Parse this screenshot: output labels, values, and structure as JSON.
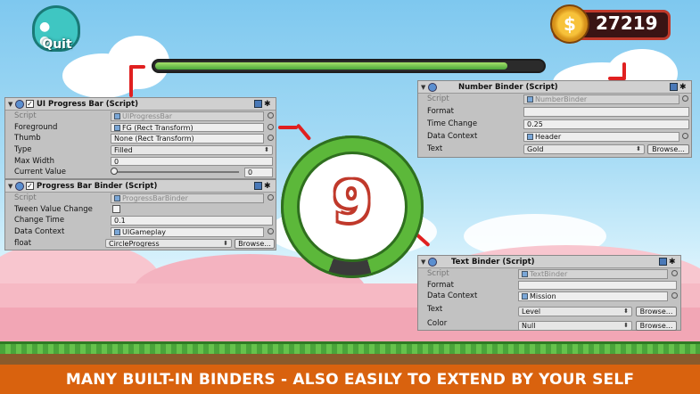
{
  "hud": {
    "quit_label": "Quit",
    "coin_symbol": "$",
    "coins": "27219",
    "top_progress": 0.91,
    "circle_progress": 0.9,
    "circle_value": "9"
  },
  "panels": {
    "ui_progress_bar": {
      "title": "UI Progress Bar (Script)",
      "rows": [
        {
          "label": "Script",
          "value": "UIProgressBar"
        },
        {
          "label": "Foreground",
          "value": "FG (Rect Transform)"
        },
        {
          "label": "Thumb",
          "value": "None (Rect Transform)"
        },
        {
          "label": "Type",
          "value": "Filled"
        },
        {
          "label": "Max Width",
          "value": "0"
        },
        {
          "label": "Current Value",
          "value": "0"
        }
      ]
    },
    "progress_bar_binder": {
      "title": "Progress Bar Binder (Script)",
      "rows": [
        {
          "label": "Script",
          "value": "ProgressBarBinder"
        },
        {
          "label": "Tween Value Change",
          "value": ""
        },
        {
          "label": "Change Time",
          "value": "0.1"
        },
        {
          "label": "Data Context",
          "value": "UIGameplay"
        },
        {
          "label": "float",
          "value": "CircleProgress",
          "button": "Browse..."
        }
      ]
    },
    "number_binder": {
      "title": "Number Binder (Script)",
      "rows": [
        {
          "label": "Script",
          "value": "NumberBinder"
        },
        {
          "label": "Format",
          "value": ""
        },
        {
          "label": "Time Change",
          "value": "0.25"
        },
        {
          "label": "Data Context",
          "value": "Header"
        },
        {
          "label": "Text",
          "value": "Gold",
          "button": "Browse..."
        }
      ]
    },
    "text_binder": {
      "title": "Text Binder (Script)",
      "rows": [
        {
          "label": "Script",
          "value": "TextBinder"
        },
        {
          "label": "Format",
          "value": ""
        },
        {
          "label": "Data Context",
          "value": "Mission"
        },
        {
          "label": "Text",
          "value": "Level",
          "button": "Browse..."
        },
        {
          "label": "Color",
          "value": "Null",
          "button": "Browse..."
        }
      ]
    }
  },
  "banner": "MANY BUILT-IN BINDERS - ALSO EASILY TO EXTEND BY YOUR SELF",
  "colors": {
    "accent_red": "#e02020",
    "progress_green": "#5cb83a",
    "banner_orange": "#d9620e"
  }
}
